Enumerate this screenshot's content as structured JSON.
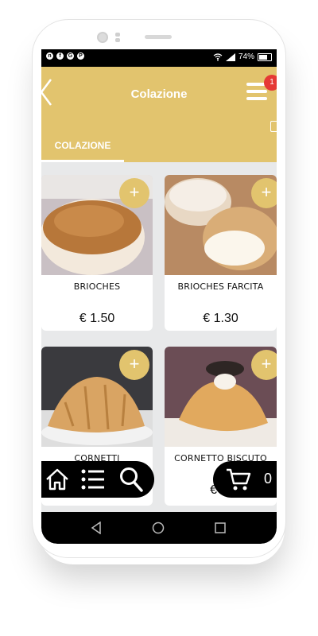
{
  "status_bar": {
    "battery": "74%",
    "app_icons": [
      "n",
      "f",
      "G",
      "P"
    ]
  },
  "app_bar": {
    "title": "Colazione",
    "cart_badge": "1"
  },
  "tabs": [
    {
      "label": "COLAZIONE",
      "active": true
    }
  ],
  "products": [
    {
      "name": "BRIOCHES",
      "price": "€ 1.50"
    },
    {
      "name": "BRIOCHES FARCITA",
      "price": "€ 1.30"
    },
    {
      "name": "CORNETTI",
      "price": ""
    },
    {
      "name": "CORNETTO BISCUTO",
      "price": "€ 1."
    }
  ],
  "cart": {
    "count": "0"
  },
  "colors": {
    "brand": "#e2c46e",
    "badge": "#e53935",
    "nav": "#000000"
  },
  "icons": [
    "back-icon",
    "menu-icon",
    "plus-icon",
    "home-icon",
    "list-icon",
    "search-icon",
    "cart-icon"
  ]
}
